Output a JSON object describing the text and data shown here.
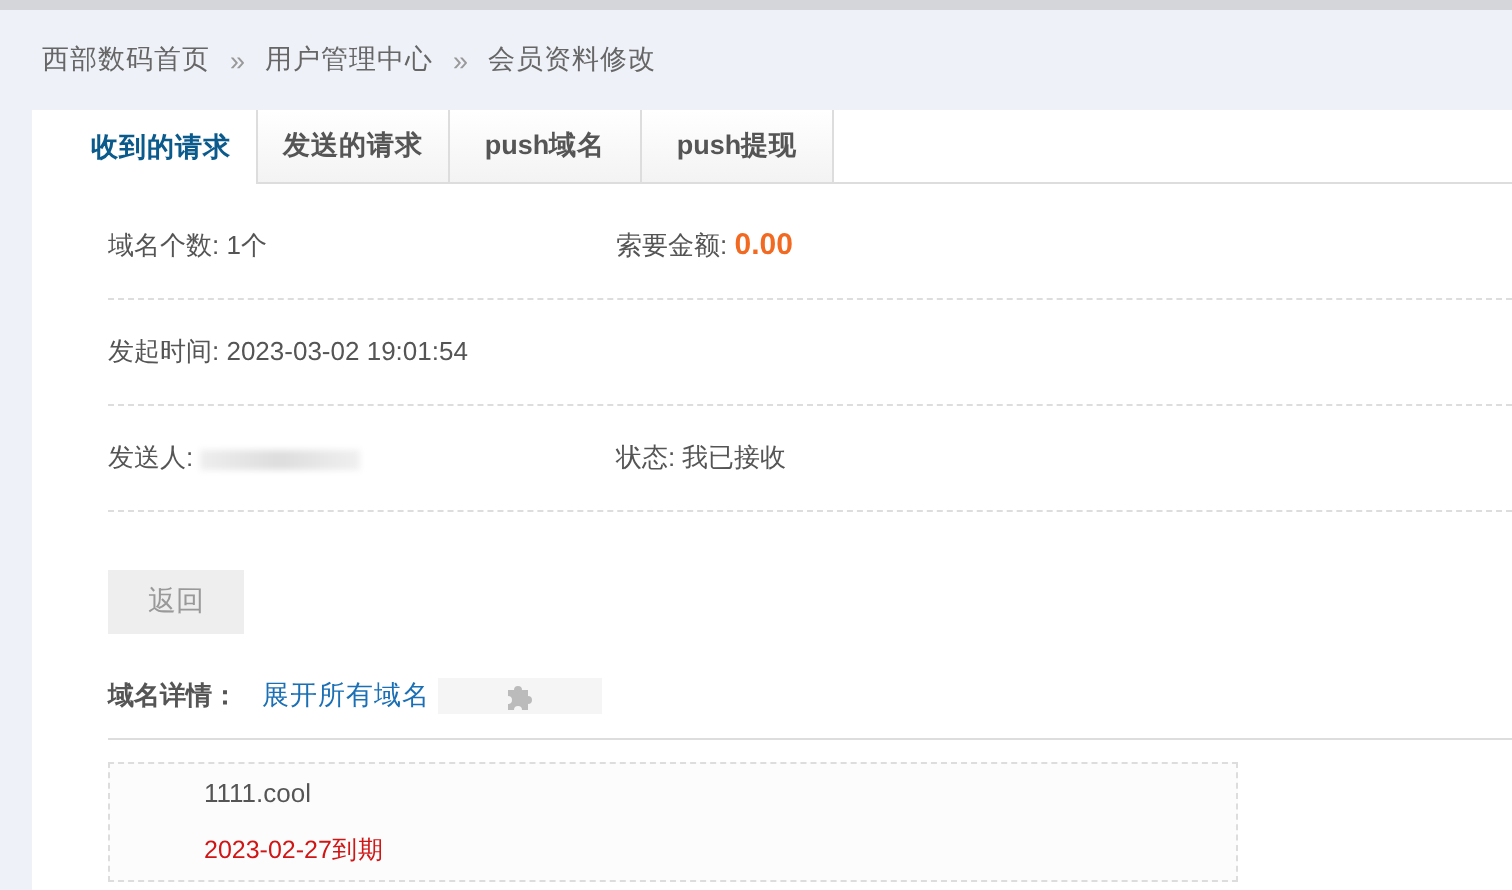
{
  "breadcrumb": {
    "separator": "»",
    "items": [
      "西部数码首页",
      "用户管理中心",
      "会员资料修改"
    ]
  },
  "tabs": [
    {
      "label": "收到的请求",
      "selected": true
    },
    {
      "label": "发送的请求",
      "selected": false
    },
    {
      "label": "push域名",
      "selected": false
    },
    {
      "label": "push提现",
      "selected": false
    }
  ],
  "info_rows": [
    {
      "fields": [
        {
          "kind": "plain",
          "label": "域名个数:",
          "value": "1个"
        },
        {
          "kind": "amount",
          "label": "索要金额:",
          "value": "0.00"
        }
      ]
    },
    {
      "fields": [
        {
          "kind": "plain",
          "label": "发起时间:",
          "value": "2023-03-02 19:01:54"
        }
      ]
    },
    {
      "fields": [
        {
          "kind": "redacted",
          "label": "发送人:"
        },
        {
          "kind": "plain",
          "label": "状态:",
          "value": "我已接收"
        }
      ]
    }
  ],
  "back_button": "返回",
  "details": {
    "label": "域名详情：",
    "link": "展开所有域名"
  },
  "domains": [
    {
      "name": "1111.cool",
      "expiry": "2023-02-27到期"
    }
  ]
}
